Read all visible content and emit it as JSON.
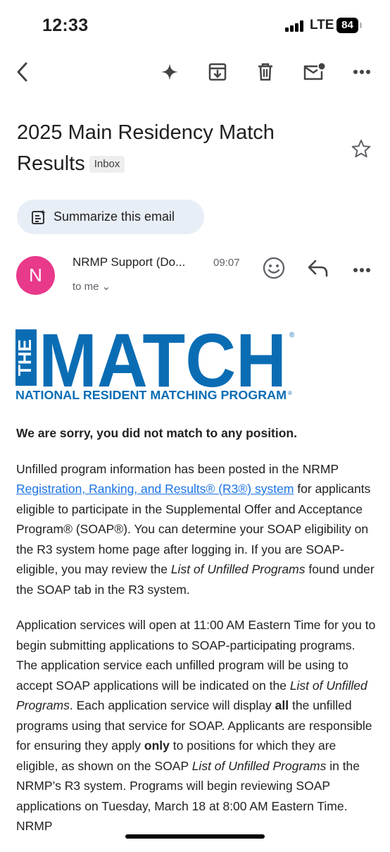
{
  "status_bar": {
    "time": "12:33",
    "network": "LTE",
    "battery": "84"
  },
  "toolbar": {
    "icons": [
      "back-arrow-icon",
      "sparkle-icon",
      "archive-icon",
      "trash-icon",
      "mark-unread-icon",
      "more-icon"
    ]
  },
  "email": {
    "subject": "2025 Main Residency Match Results",
    "label": "Inbox",
    "summarize_label": "Summarize this email",
    "sender": "NRMP Support (Do...",
    "sender_initial": "N",
    "time": "09:07",
    "to_line": "to me ⌄"
  },
  "logo": {
    "line1": "THE",
    "line2": "MATCH",
    "line3": "NATIONAL RESIDENT MATCHING PROGRAM",
    "mark": "®",
    "color": "#0a6db4"
  },
  "body": {
    "headline": "We are sorry, you did not match to any position.",
    "p1": {
      "a": "Unfilled program information has been posted in the NRMP ",
      "link": "Registration, Ranking, and Results® (R3®) system",
      "b": " for applicants eligible to participate in the Supplemental Offer and Acceptance Program® (SOAP®). You can determine your SOAP eligibility on the R3 system home page after logging in. If you are SOAP-eligible, you may review the ",
      "italic": "List of Unfilled Programs",
      "c": " found under the SOAP tab in the R3 system."
    },
    "p2": {
      "a": "Application services will open at 11:00 AM Eastern Time for you to begin submitting applications to SOAP-participating programs. The application service each unfilled program will be using to accept SOAP applications will be indicated on the ",
      "italic1": "List of Unfilled Programs",
      "b": ". Each application service will display ",
      "bold1": "all",
      "c": " the unfilled programs using that service for SOAP. Applicants are responsible for ensuring they apply ",
      "bold2": "only",
      "d": " to positions for which they are eligible, as shown on the SOAP ",
      "italic2": "List of Unfilled Programs",
      "e": " in the NRMP’s R3 system. Programs will begin reviewing SOAP applications on Tuesday, March 18 at 8:00 AM Eastern Time. NRMP"
    }
  },
  "colors": {
    "accent": "#1a73e8",
    "avatar": "#e8398b",
    "chip": "#e8eef6"
  }
}
